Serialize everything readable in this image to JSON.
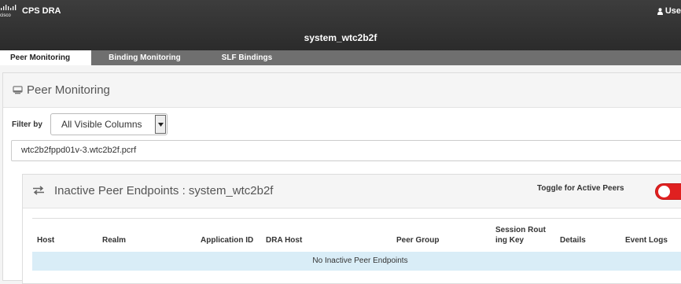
{
  "topbar": {
    "logo_icon": "cisco-logo-icon",
    "app_name": "CPS DRA",
    "system_title": "system_wtc2b2f",
    "user_label": "Use",
    "user_icon": "user-icon"
  },
  "tabs": [
    {
      "label": "Peer Monitoring",
      "active": true
    },
    {
      "label": "Binding Monitoring",
      "active": false
    },
    {
      "label": "SLF Bindings",
      "active": false
    }
  ],
  "panel": {
    "icon": "monitor-icon",
    "title": "Peer Monitoring",
    "filter_label": "Filter by",
    "filter_value": "All Visible Columns",
    "search_value": "wtc2b2fppd01v-3.wtc2b2f.pcrf"
  },
  "inactive": {
    "icon": "swap-arrows-icon",
    "title": "Inactive Peer Endpoints : system_wtc2b2f",
    "toggle_label": "Toggle for Active Peers",
    "toggle_on": true,
    "columns": [
      "Host",
      "Realm",
      "Application ID",
      "DRA Host",
      "Peer Group",
      "Session Rout\ning Key",
      "Details",
      "Event Logs"
    ],
    "empty_message": "No Inactive Peer Endpoints"
  },
  "colors": {
    "topbar": "#333333",
    "tabbar": "#6f6f6f",
    "toggle": "#e02020",
    "empty_row": "#d9edf7"
  }
}
